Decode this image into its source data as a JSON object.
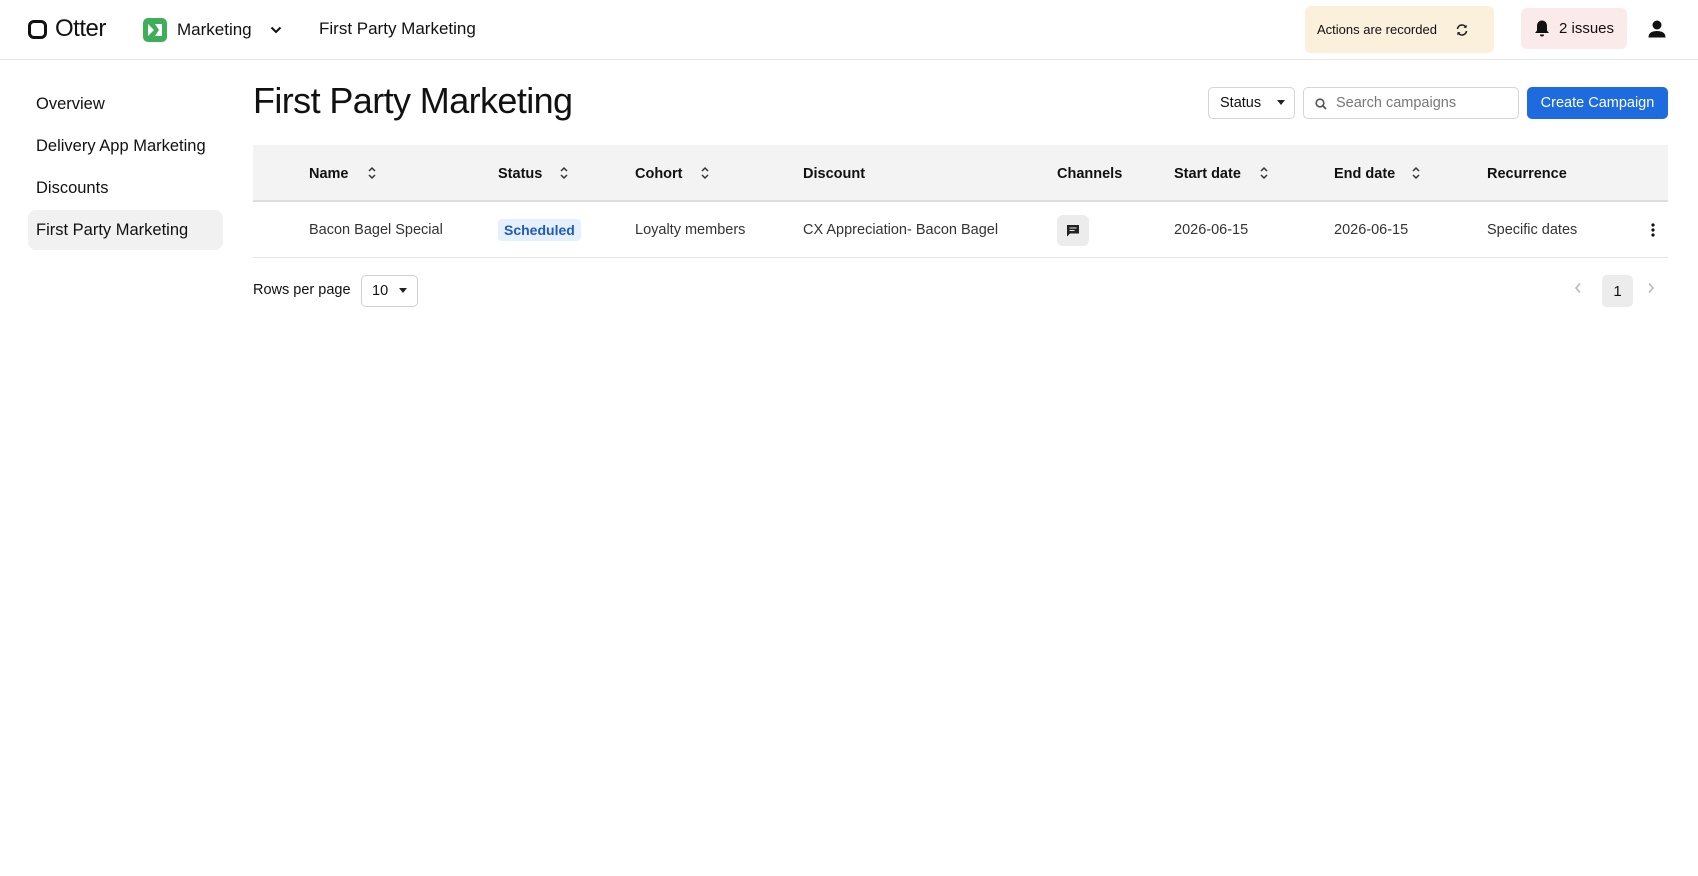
{
  "header": {
    "logo_text": "Otter",
    "app_name": "Marketing",
    "crumb": "First Party Marketing",
    "recorded_text": "Actions are recorded",
    "issues_text": "2 issues"
  },
  "sidebar": {
    "items": [
      {
        "label": "Overview"
      },
      {
        "label": "Delivery App Marketing"
      },
      {
        "label": "Discounts"
      },
      {
        "label": "First Party Marketing"
      }
    ]
  },
  "main": {
    "title": "First Party Marketing",
    "status_filter_label": "Status",
    "search_placeholder": "Search campaigns",
    "search_value": "",
    "create_label": "Create Campaign"
  },
  "table": {
    "columns": [
      "Name",
      "Status",
      "Cohort",
      "Discount",
      "Channels",
      "Start date",
      "End date",
      "Recurrence"
    ],
    "rows": [
      {
        "name": "Bacon Bagel Special",
        "status": "Scheduled",
        "cohort": "Loyalty members",
        "discount": "CX Appreciation- Bacon Bagel",
        "channel_icon": "sms-icon",
        "start_date": "2026-06-15",
        "end_date": "2026-06-15",
        "recurrence": "Specific dates"
      }
    ]
  },
  "pagination": {
    "rows_label": "Rows per page",
    "rows_value": "10",
    "current_page": "1"
  },
  "colors": {
    "accent": "#1e6be0",
    "brand_green": "#3fae58",
    "recorded_bg": "#fbf0dc",
    "issues_bg": "#fbeaea",
    "status_badge_bg": "#e6f0fc",
    "status_badge_text": "#1d5bbf"
  }
}
